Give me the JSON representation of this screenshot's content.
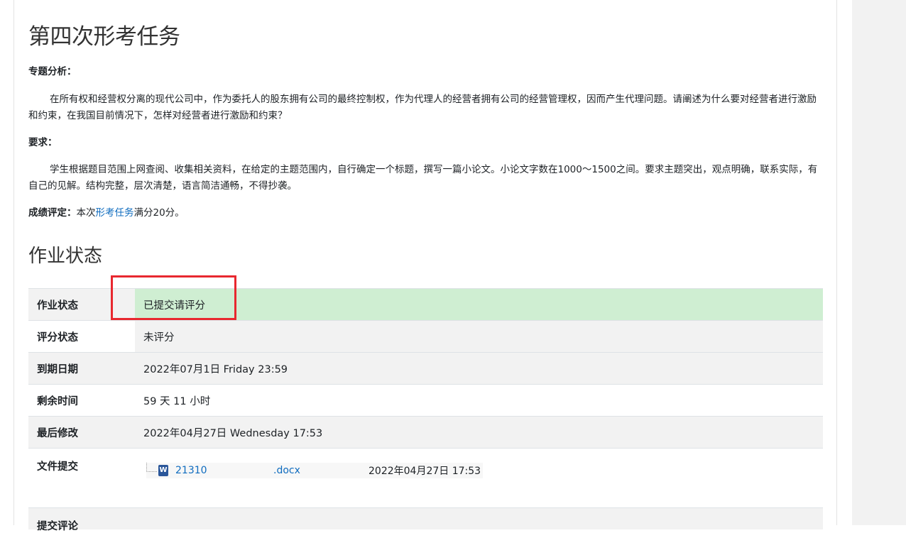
{
  "assignment": {
    "title": "第四次形考任务",
    "topic_label": "专题分析：",
    "topic_text": "在所有权和经营权分离的现代公司中，作为委托人的股东拥有公司的最终控制权，作为代理人的经营者拥有公司的经营管理权，因而产生代理问题。请阐述为什么要对经营者进行激励和约束，在我国目前情况下，怎样对经营者进行激励和约束？",
    "requirement_label": "要求：",
    "requirement_text": "学生根据题目范围上网查阅、收集相关资料，在给定的主题范围内，自行确定一个标题，撰写一篇小论文。小论文字数在1000～1500之间。要求主题突出，观点明确，联系实际，有自己的见解。结构完整，层次清楚，语言简洁通畅，不得抄袭。",
    "grading_label": "成绩评定：",
    "grading_prefix": "本次",
    "grading_link": "形考任务",
    "grading_suffix": "满分20分。"
  },
  "status_section": {
    "title": "作业状态",
    "rows": [
      {
        "label": "作业状态",
        "value": "已提交请评分"
      },
      {
        "label": "评分状态",
        "value": "未评分"
      },
      {
        "label": "到期日期",
        "value": "2022年07月1日 Friday 23:59"
      },
      {
        "label": "剩余时间",
        "value": "59 天 11 小时"
      },
      {
        "label": "最后修改",
        "value": "2022年04月27日 Wednesday 17:53"
      }
    ],
    "files_label": "文件提交",
    "file": {
      "icon": "word-doc-icon",
      "name": "21310                     .docx",
      "date": "2022年04月27日 17:53"
    },
    "comments_label": "提交评论"
  },
  "colors": {
    "submitted_bg": "#cfeed2",
    "link": "#0f6cbf",
    "highlight": "#e8282f"
  }
}
